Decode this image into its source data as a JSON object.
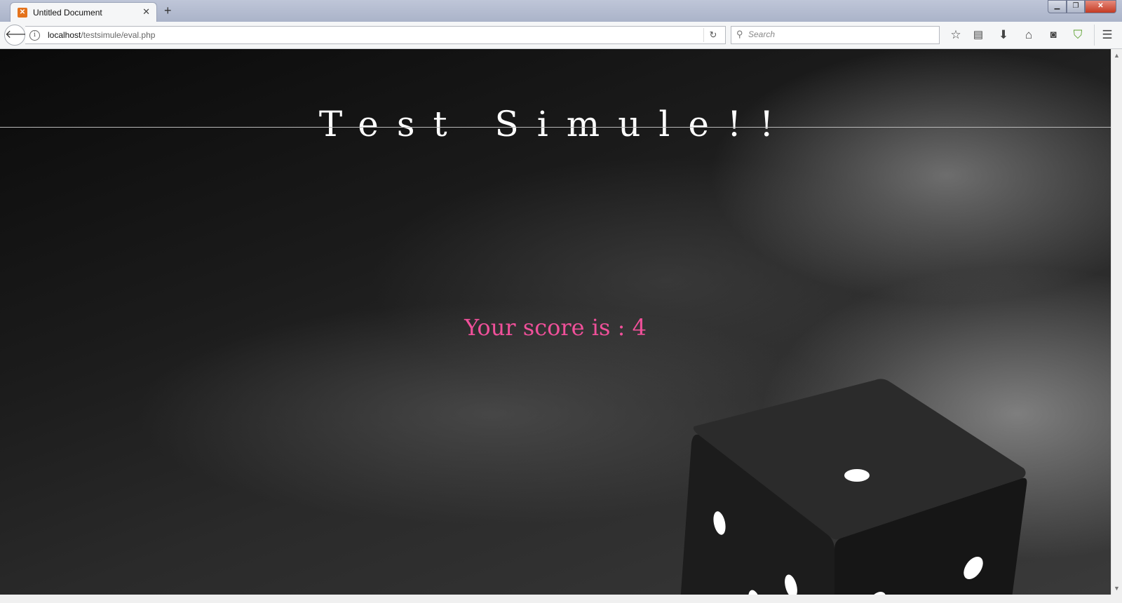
{
  "browser": {
    "tab": {
      "title": "Untitled Document",
      "favicon": "xampp-icon"
    },
    "new_tab_label": "+",
    "url": {
      "host": "localhost",
      "path": "/testsimule/eval.php"
    },
    "search": {
      "placeholder": "Search"
    },
    "toolbar_icons": [
      "bookmark-star-icon",
      "reading-list-icon",
      "downloads-icon",
      "home-icon",
      "pocket-icon",
      "shield-addon-icon",
      "menu-icon"
    ]
  },
  "page": {
    "title": "Test Simule!!",
    "score_text": "Your score is : 4",
    "colors": {
      "score": "#f0509a",
      "title": "#ffffff",
      "background": "#1a1a1a"
    }
  }
}
